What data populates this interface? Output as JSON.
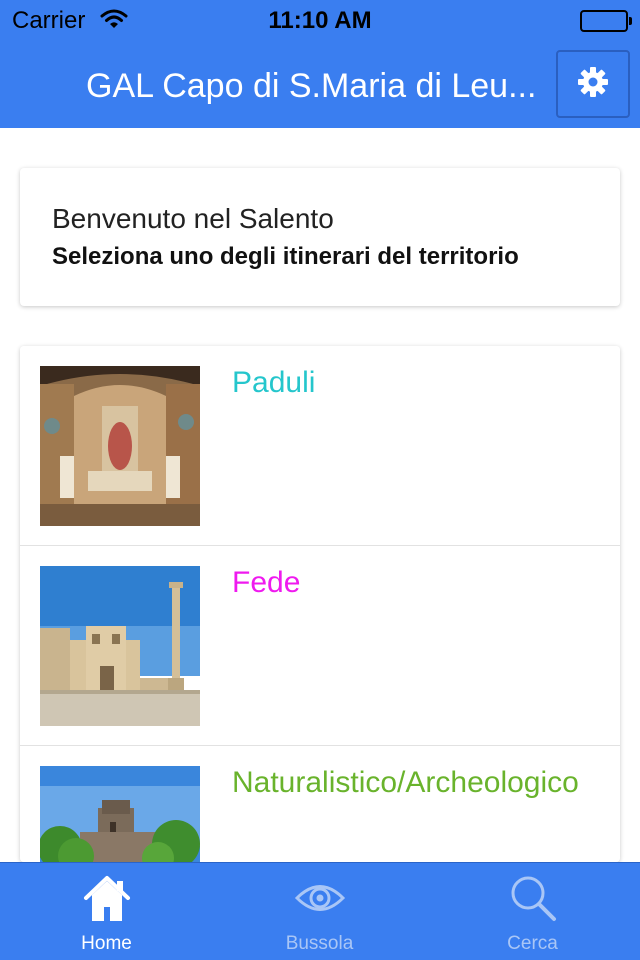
{
  "status_bar": {
    "carrier": "Carrier",
    "time": "11:10 AM"
  },
  "nav": {
    "title": "GAL Capo di S.Maria di Leu..."
  },
  "welcome": {
    "title": "Benvenuto nel Salento",
    "subtitle": "Seleziona uno degli itinerari del territorio"
  },
  "itineraries": [
    {
      "label": "Paduli",
      "color": "#25c6cc",
      "image": "church-interior-photo"
    },
    {
      "label": "Fede",
      "color": "#ef1aef",
      "image": "basilica-column-photo"
    },
    {
      "label": "Naturalistico/Archeologico",
      "color": "#69b32c",
      "image": "tower-trees-photo"
    }
  ],
  "tabs": [
    {
      "label": "Home",
      "icon": "home-icon",
      "active": true
    },
    {
      "label": "Bussola",
      "icon": "eye-icon",
      "active": false
    },
    {
      "label": "Cerca",
      "icon": "search-icon",
      "active": false
    }
  ],
  "colors": {
    "accent": "#3a7ef0"
  }
}
